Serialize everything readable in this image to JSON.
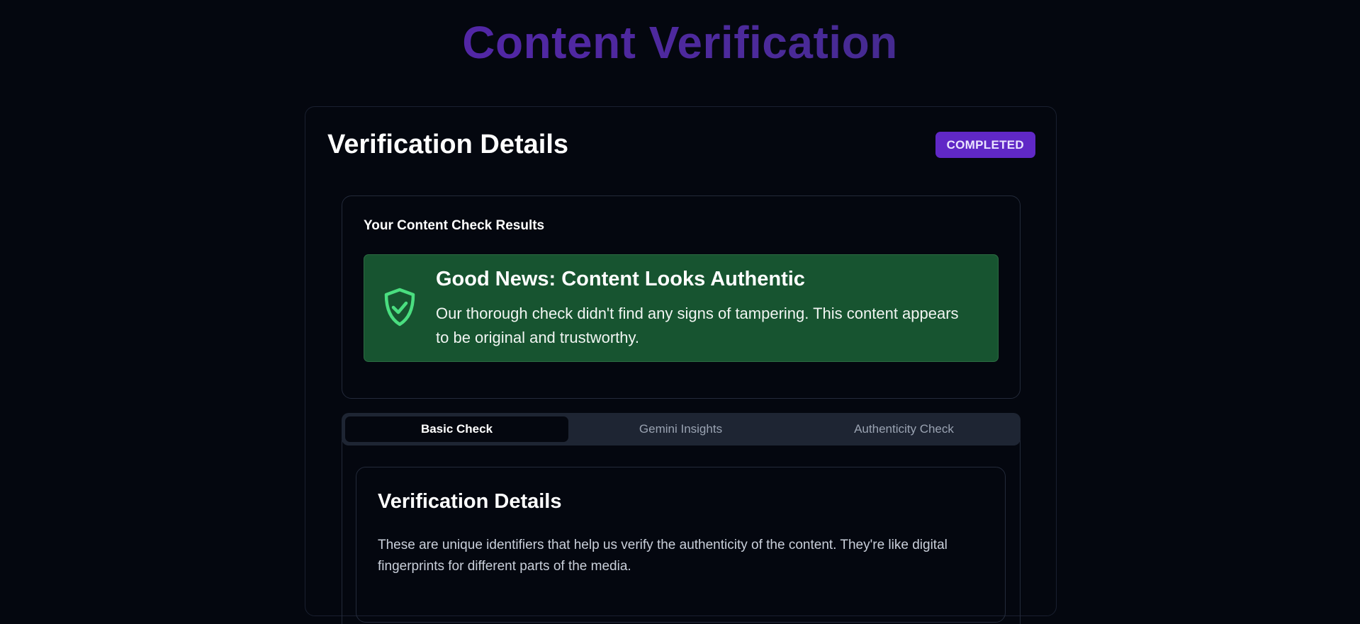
{
  "page": {
    "title": "Content Verification"
  },
  "card": {
    "heading": "Verification Details",
    "status_badge": "COMPLETED"
  },
  "results": {
    "title": "Your Content Check Results",
    "alert": {
      "icon": "shield-check-icon",
      "title": "Good News: Content Looks Authentic",
      "message": "Our thorough check didn't find any signs of tampering. This content appears to be original and trustworthy."
    }
  },
  "tabs": [
    {
      "label": "Basic Check",
      "active": true
    },
    {
      "label": "Gemini Insights",
      "active": false
    },
    {
      "label": "Authenticity Check",
      "active": false
    }
  ],
  "details": {
    "title": "Verification Details",
    "description": "These are unique identifiers that help us verify the authenticity of the content. They're like digital fingerprints for different parts of the media."
  },
  "colors": {
    "background": "#04070f",
    "accent": "#6028c6",
    "success_bg": "#175430",
    "success_icon": "#4ade80"
  }
}
